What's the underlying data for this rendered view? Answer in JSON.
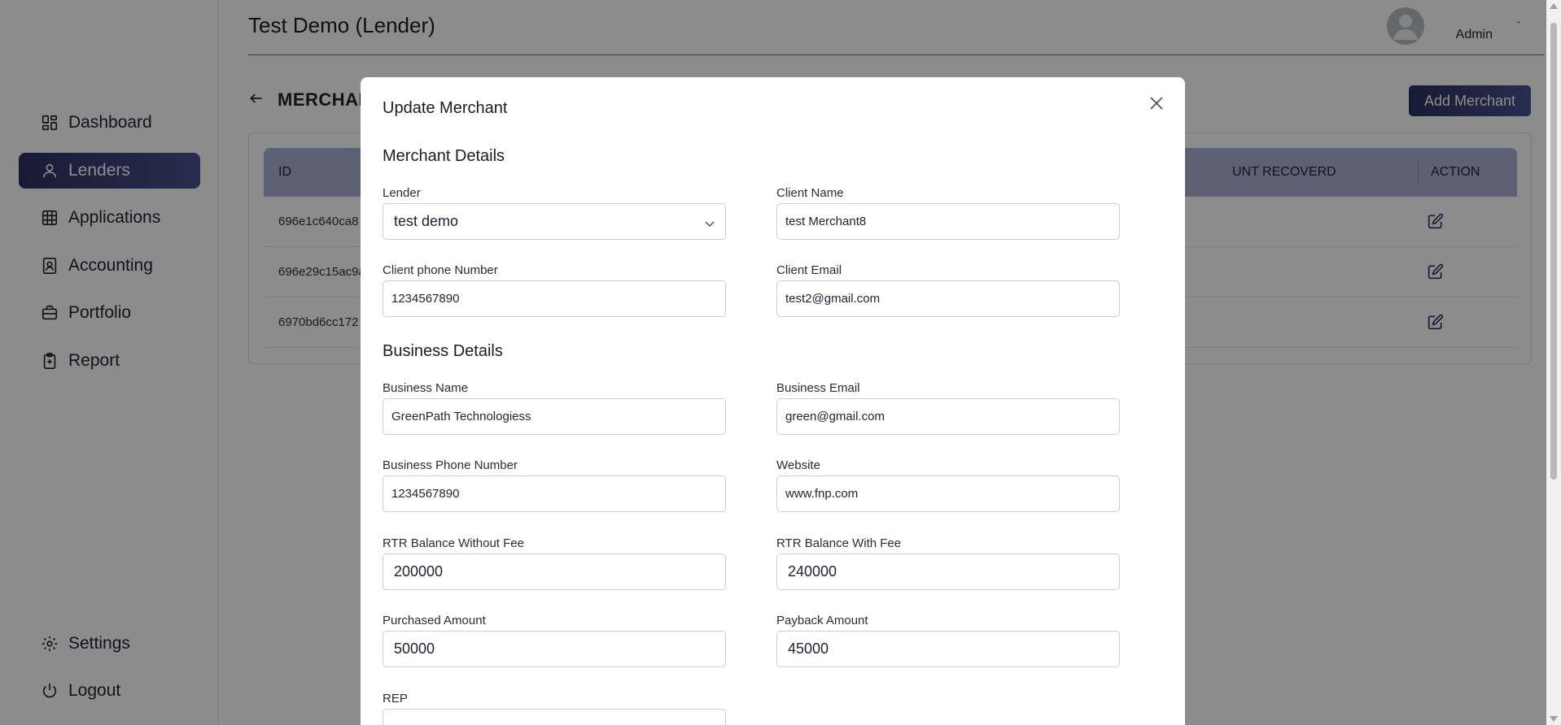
{
  "sidebar": {
    "items": [
      {
        "label": "Dashboard",
        "icon": "dashboard-icon"
      },
      {
        "label": "Lenders",
        "icon": "user-icon",
        "active": true
      },
      {
        "label": "Applications",
        "icon": "table-icon"
      },
      {
        "label": "Accounting",
        "icon": "contact-book-icon"
      },
      {
        "label": "Portfolio",
        "icon": "briefcase-icon"
      },
      {
        "label": "Report",
        "icon": "clipboard-icon"
      }
    ],
    "bottom_items": [
      {
        "label": "Settings",
        "icon": "gear-icon"
      },
      {
        "label": "Logout",
        "icon": "power-icon"
      }
    ]
  },
  "header": {
    "title": "Test Demo (Lender)",
    "user_name": "Admin",
    "menu_glyph": "-"
  },
  "main": {
    "section_title": "MERCHAN",
    "add_button": "Add Merchant",
    "table": {
      "columns": [
        "ID",
        "UNT RECOVERD",
        "ACTION"
      ],
      "rows": [
        {
          "id": "696e1c640ca8"
        },
        {
          "id": "696e29c15ac9a"
        },
        {
          "id": "6970bd6cc172"
        }
      ]
    }
  },
  "modal": {
    "title": "Update Merchant",
    "merchant_section": "Merchant Details",
    "business_section": "Business Details",
    "fields": {
      "lender": {
        "label": "Lender",
        "value": "test demo"
      },
      "client_name": {
        "label": "Client Name",
        "value": "test Merchant8"
      },
      "client_phone": {
        "label": "Client phone Number",
        "value": "1234567890"
      },
      "client_email": {
        "label": "Client Email",
        "value": "test2@gmail.com"
      },
      "business_name": {
        "label": "Business Name",
        "value": "GreenPath Technologiess"
      },
      "business_email": {
        "label": "Business Email",
        "value": "green@gmail.com"
      },
      "business_phone": {
        "label": "Business Phone Number",
        "value": "1234567890"
      },
      "website": {
        "label": "Website",
        "value": "www.fnp.com"
      },
      "rtr_without_fee": {
        "label": "RTR Balance Without Fee",
        "value": "200000"
      },
      "rtr_with_fee": {
        "label": "RTR Balance With Fee",
        "value": "240000"
      },
      "purchased_amount": {
        "label": "Purchased Amount",
        "value": "50000"
      },
      "payback_amount": {
        "label": "Payback Amount",
        "value": "45000"
      },
      "rep": {
        "label": "REP",
        "value": ""
      }
    }
  },
  "colors": {
    "accent": "#2b3160",
    "accent_light": "#4a5290",
    "table_header": "#a9b1d4"
  }
}
